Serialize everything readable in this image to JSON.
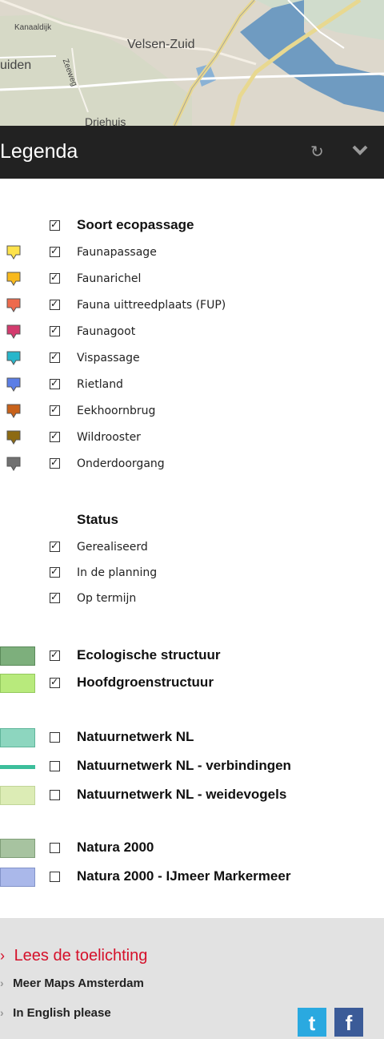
{
  "map": {
    "labels": [
      "Kanaaldijk",
      "Velsen-Zuid",
      "uiden",
      "Zeeweg",
      "Driehuis"
    ]
  },
  "header": {
    "title": "Legenda",
    "icons": [
      "refresh-icon",
      "chevron-down-icon"
    ]
  },
  "colors": {
    "header_bg": "#222222",
    "footer_bg": "#e2e2e2",
    "accent_red": "#d5102a",
    "twitter": "#2aa9e0",
    "facebook": "#3b5b98"
  },
  "legend": {
    "ecopassage": {
      "heading": "Soort ecopassage",
      "items": [
        {
          "label": "Faunapassage",
          "color": "#fde24b"
        },
        {
          "label": "Faunarichel",
          "color": "#f8b91d"
        },
        {
          "label": "Fauna uittreedplaats (FUP)",
          "color": "#ee6a4c"
        },
        {
          "label": "Faunagoot",
          "color": "#d33b6e"
        },
        {
          "label": "Vispassage",
          "color": "#27b6cb"
        },
        {
          "label": "Rietland",
          "color": "#5b7ee6"
        },
        {
          "label": "Eekhoornbrug",
          "color": "#c8621a"
        },
        {
          "label": "Wildrooster",
          "color": "#8d6a12"
        },
        {
          "label": "Onderdoorgang",
          "color": "#717171"
        }
      ]
    },
    "status": {
      "heading": "Status",
      "items": [
        "Gerealiseerd",
        "In de planning",
        "Op termijn"
      ]
    },
    "layers": [
      {
        "label": "Ecologische structuur",
        "checked": true,
        "color": "#7daf7c",
        "style": "fill"
      },
      {
        "label": "Hoofdgroenstructuur",
        "checked": true,
        "color": "#b8ea7c",
        "style": "fill"
      },
      {
        "label": "Natuurnetwerk NL",
        "checked": false,
        "color": "#8dd6bf",
        "style": "fill"
      },
      {
        "label": "Natuurnetwerk NL - verbindingen",
        "checked": false,
        "color": "#3cbe9b",
        "style": "line"
      },
      {
        "label": "Natuurnetwerk NL - weidevogels",
        "checked": false,
        "color": "#dcecb5",
        "style": "fill"
      },
      {
        "label": "Natura 2000",
        "checked": false,
        "color": "#a7c3a0",
        "style": "fill"
      },
      {
        "label": "Natura 2000 - IJmeer Markermeer",
        "checked": false,
        "color": "#aab8ea",
        "style": "fill"
      }
    ]
  },
  "footer": {
    "toelichting": "Lees de toelichting",
    "meer_maps": "Meer Maps Amsterdam",
    "english": "In English please",
    "twitter": "t",
    "facebook": "f"
  }
}
